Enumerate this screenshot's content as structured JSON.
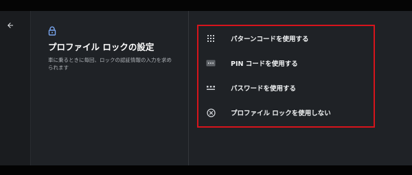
{
  "header": {
    "back_icon": "arrow-back-icon"
  },
  "left": {
    "lock_icon": "lock-icon",
    "title": "プロファイル ロックの設定",
    "description": "車に乗るときに毎回、ロックの認証情報の入力を求められます"
  },
  "options": [
    {
      "label": "パターンコードを使用する",
      "icon": "pattern-grid-icon"
    },
    {
      "label": "PIN コードを使用する",
      "icon": "pin-keypad-icon"
    },
    {
      "label": "パスワードを使用する",
      "icon": "password-dots-icon"
    },
    {
      "label": "プロファイル ロックを使用しない",
      "icon": "cancel-circle-icon"
    }
  ],
  "colors": {
    "accent": "#7aa7f0",
    "highlight": "#d8141c",
    "background": "#1f2226"
  }
}
